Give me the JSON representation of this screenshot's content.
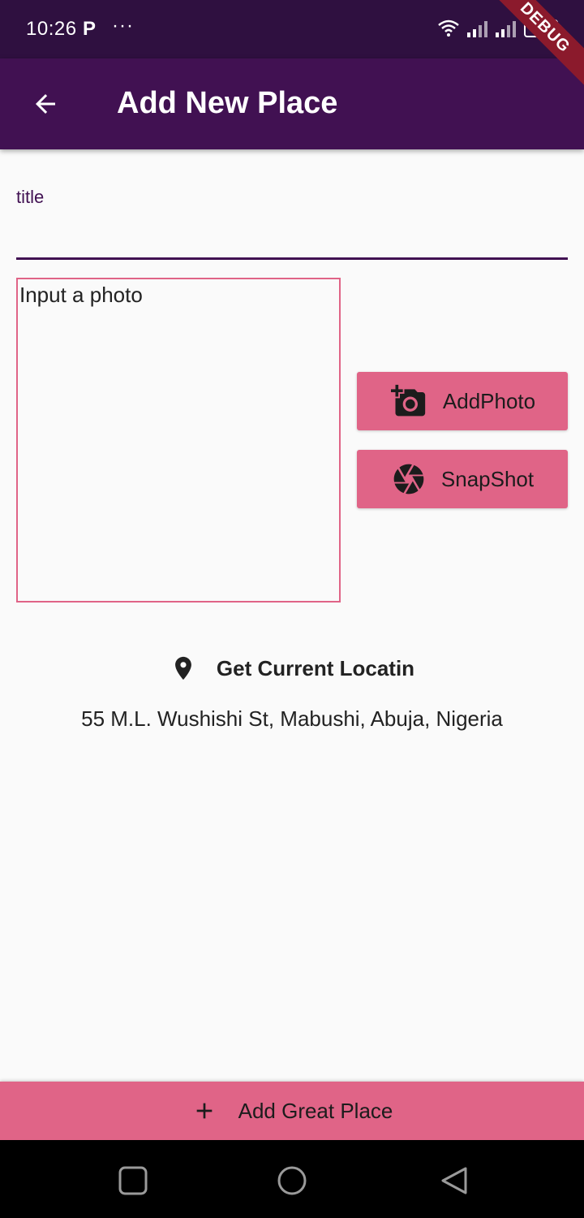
{
  "status_bar": {
    "time": "10:26",
    "app_indicator": "P",
    "more_indicator": "···",
    "icons": [
      "wifi-icon",
      "signal-icon",
      "signal-icon",
      "battery-charging-icon"
    ]
  },
  "debug_banner": "DEBUG",
  "app_bar": {
    "title": "Add New Place",
    "back_icon": "arrow-back-icon",
    "background_color": "#411152"
  },
  "form": {
    "title_label": "title",
    "title_value": "",
    "photo_placeholder": "Input a photo",
    "add_photo_label": "AddPhoto",
    "add_photo_icon": "add-a-photo-icon",
    "snapshot_label": "SnapShot",
    "snapshot_icon": "camera-shutter-icon",
    "accent_color": "#e06487"
  },
  "location": {
    "button_label": "Get Current Locatin",
    "icon": "location-pin-icon",
    "address": "55 M.L. Wushishi St, Mabushi, Abuja, Nigeria"
  },
  "submit": {
    "label": "Add Great Place",
    "icon": "plus-icon"
  },
  "nav_bar": {
    "items": [
      "recents-icon",
      "home-icon",
      "back-icon"
    ]
  }
}
